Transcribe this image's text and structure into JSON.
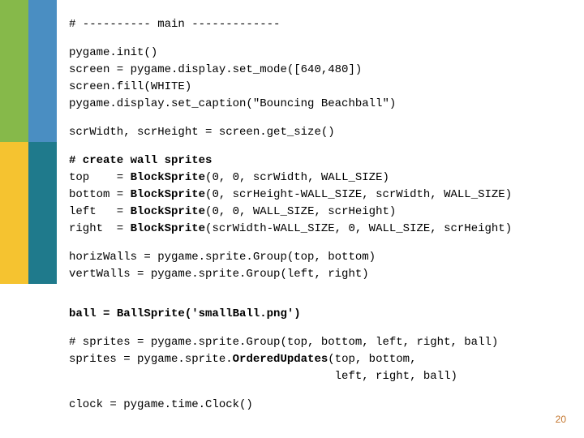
{
  "page_number": "20",
  "code": {
    "l01": "# ---------- main -------------",
    "l02": "pygame.init()",
    "l03": "screen = pygame.display.set_mode([640,480])",
    "l04": "screen.fill(WHITE)",
    "l05": "pygame.display.set_caption(\"Bouncing Beachball\")",
    "l06": "scrWidth, scrHeight = screen.get_size()",
    "l07a": "# create wall sprites",
    "l07b": "top    = ",
    "l07c": "BlockSprite",
    "l07d": "(0, 0, scrWidth, WALL_SIZE)",
    "l08a": "bottom = ",
    "l08b": "BlockSprite",
    "l08c": "(0, scrHeight-WALL_SIZE, scrWidth, WALL_SIZE)",
    "l09a": "left   = ",
    "l09b": "BlockSprite",
    "l09c": "(0, 0, WALL_SIZE, scrHeight)",
    "l10a": "right  = ",
    "l10b": "BlockSprite",
    "l10c": "(scrWidth-WALL_SIZE, 0, WALL_SIZE, scrHeight)",
    "l11": "horizWalls = pygame.sprite.Group(top, bottom)",
    "l12": "vertWalls = pygame.sprite.Group(left, right)",
    "l13a": "ball = ",
    "l13b": "BallSprite('smallBall.png')",
    "l14": "# sprites = pygame.sprite.Group(top, bottom, left, right, ball)",
    "l15a": "sprites = pygame.sprite.",
    "l15b": "OrderedUpdates",
    "l15c": "(top, bottom,",
    "l16": "                                       left, right, ball)",
    "l17": "clock = pygame.time.Clock()"
  }
}
